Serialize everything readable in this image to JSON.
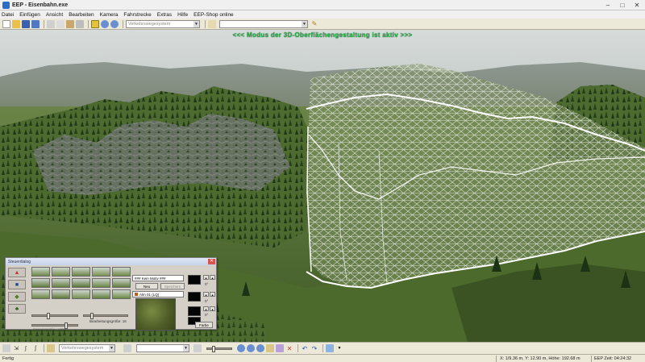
{
  "window": {
    "title": "EEP - Eisenbahn.exe",
    "minimize": "–",
    "maximize": "□",
    "close": "✕"
  },
  "menu": [
    "Datei",
    "Einfügen",
    "Ansicht",
    "Bearbeiten",
    "Kamera",
    "Fahrstrecke",
    "Extras",
    "Hilfe",
    "EEP-Shop online"
  ],
  "toolbar": {
    "select1_value": "Verkehrswegesystem",
    "icons": [
      "new-file-icon",
      "open-folder-icon",
      "save-icon",
      "save-as-icon",
      "cut-icon",
      "copy-icon",
      "paste-icon",
      "print-icon",
      "landscape-mode-icon",
      "zoom-in-icon",
      "zoom-out-icon"
    ]
  },
  "viewport": {
    "banner": "<<<  Modus der 3D-Oberflächengestaltung ist aktiv  >>>",
    "colors": {
      "banner": "#2ab04a",
      "terrain": "#5b7a3a",
      "wireframe": "#ffffff"
    }
  },
  "dialog": {
    "title": "Steuerdialog",
    "field_motiv": "### Kein Motiv ###",
    "btn_neu": "Neu",
    "btn_speichern": "Speichern",
    "texture_value": "Alm 01 (LQ)",
    "label_bearbeitungsgroesse": "Bearbeitungsgröße: 16",
    "label_left_slider": "Gesamtgröße: 100%",
    "btn_farbe": "Farbe",
    "angle_values": [
      "0°",
      "0°",
      "0°"
    ]
  },
  "bottombar": {
    "select_value": "Verkehrswegesystem"
  },
  "status": {
    "left": "Fertig",
    "coords": "X: 1/9.36 m, Y: 12.90 m, Höhe: 192.68 m",
    "time": "EEP Zeit: 04:24:32"
  }
}
